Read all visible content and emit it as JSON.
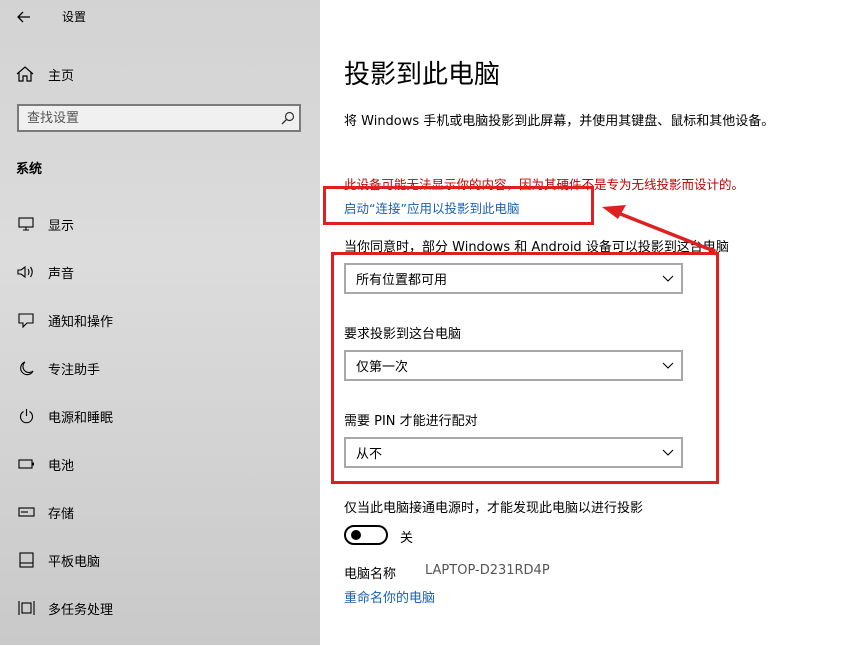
{
  "window": {
    "title": "设置"
  },
  "sidebar": {
    "home_label": "主页",
    "search_placeholder": "查找设置",
    "section_title": "系统",
    "items": [
      {
        "label": "显示",
        "icon": "monitor-icon"
      },
      {
        "label": "声音",
        "icon": "speaker-icon"
      },
      {
        "label": "通知和操作",
        "icon": "notification-icon"
      },
      {
        "label": "专注助手",
        "icon": "moon-icon"
      },
      {
        "label": "电源和睡眠",
        "icon": "power-icon"
      },
      {
        "label": "电池",
        "icon": "battery-icon"
      },
      {
        "label": "存储",
        "icon": "storage-icon"
      },
      {
        "label": "平板电脑",
        "icon": "tablet-icon"
      },
      {
        "label": "多任务处理",
        "icon": "multitask-icon"
      }
    ]
  },
  "main": {
    "title": "投影到此电脑",
    "description": "将 Windows 手机或电脑投影到此屏幕，并使用其键盘、鼠标和其他设备。",
    "warning": "此设备可能无法显示你的内容，因为其硬件不是专为无线投影而设计的。",
    "launch_link": "启动“连接”应用以投影到此电脑",
    "availability_label": "当你同意时，部分 Windows 和 Android 设备可以投影到这台电脑",
    "availability_value": "所有位置都可用",
    "ask_label": "要求投影到这台电脑",
    "ask_value": "仅第一次",
    "pin_label": "需要 PIN 才能进行配对",
    "pin_value": "从不",
    "power_label": "仅当此电脑接通电源时，才能发现此电脑以进行投影",
    "toggle_state": "关",
    "pc_name_label": "电脑名称",
    "pc_name_value": "LAPTOP-D231RD4P",
    "rename_link": "重命名你的电脑"
  },
  "colors": {
    "accent": "#1a5fb4",
    "warning": "#c00000",
    "annotation": "#e02020"
  }
}
